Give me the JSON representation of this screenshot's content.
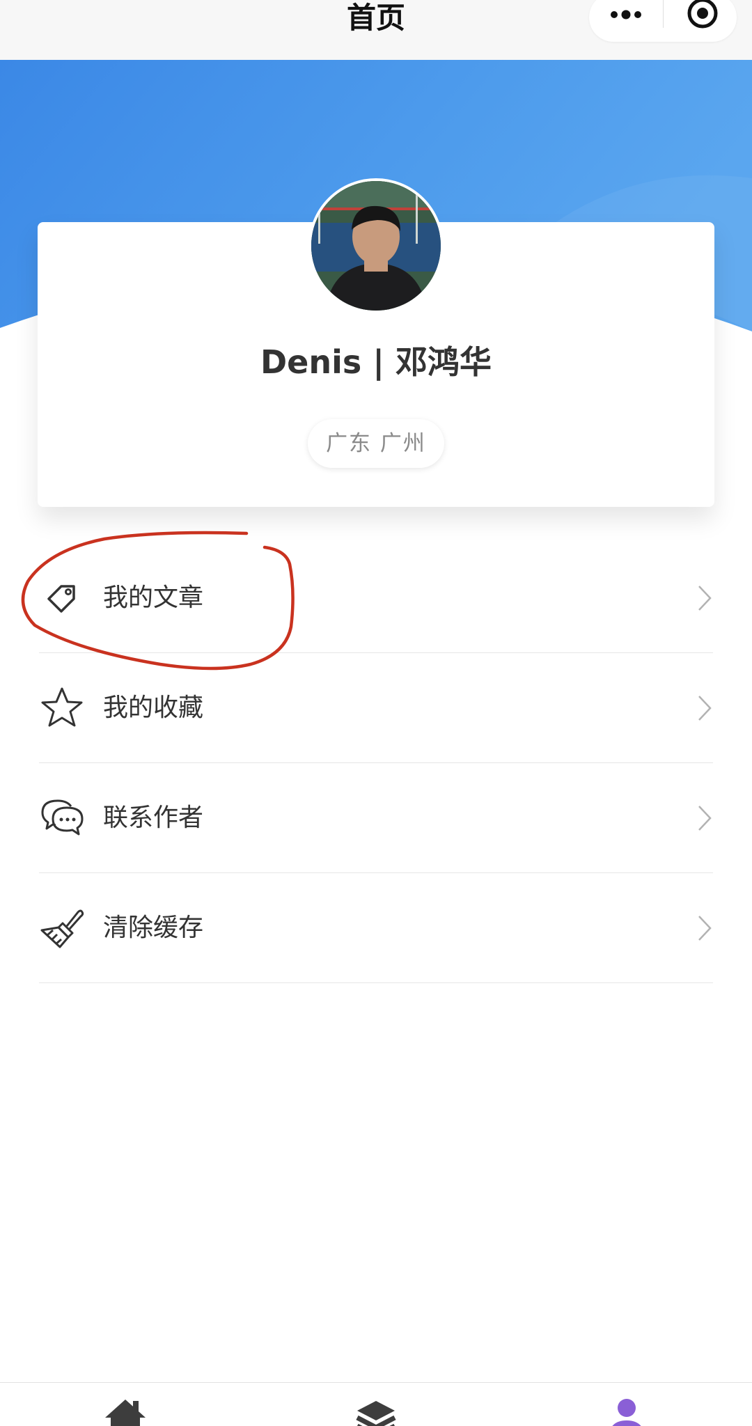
{
  "navbar": {
    "title": "首页"
  },
  "profile": {
    "name": "Denis | 邓鸿华",
    "location": "广东 广州"
  },
  "menu": {
    "items": [
      {
        "label": "我的文章",
        "icon": "tag-icon"
      },
      {
        "label": "我的收藏",
        "icon": "star-icon"
      },
      {
        "label": "联系作者",
        "icon": "chat-icon"
      },
      {
        "label": "清除缓存",
        "icon": "brush-icon"
      }
    ]
  },
  "tabbar": {
    "tabs": [
      {
        "icon": "home-icon",
        "active": false
      },
      {
        "icon": "layers-icon",
        "active": false
      },
      {
        "icon": "user-icon",
        "active": true
      }
    ]
  },
  "colors": {
    "header_blue": "#3f8fe8",
    "active_tab": "#8a5fd6",
    "annotation_red": "#c9321f"
  }
}
